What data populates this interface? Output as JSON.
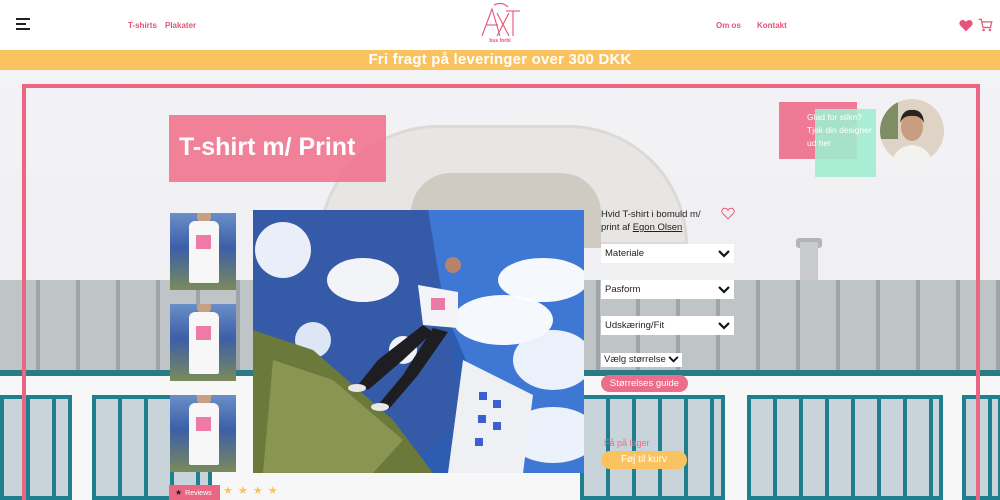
{
  "nav": {
    "links": [
      "T-shirts",
      "Plakater"
    ],
    "right_links": [
      "Om os",
      "Kontakt"
    ],
    "logo_text": "AXT",
    "logo_sub": "bus forbi"
  },
  "banner": {
    "text": "Fri fragt på leveringer over 300 DKK"
  },
  "product": {
    "title": "T-shirt m/ Print",
    "description_prefix": "Hvid T-shirt i bomuld m/ print af ",
    "designer_link": "Egon Olsen",
    "selects": [
      "Materiale",
      "Pasform",
      "Udskæring/Fit",
      "Vælg størrelse"
    ],
    "size_guide": "Størrelses guide",
    "stock_status": "Få på lager",
    "add_to_cart": "Føj til kurv"
  },
  "designer": {
    "text": "Glad for stikn? Tjek din designer ud her"
  },
  "reviews": {
    "label": "Reviews",
    "star_icon": "★",
    "stars": "★ ★ ★ ★"
  },
  "colors": {
    "accent_pink": "#e96783",
    "accent_yellow": "#fbc35f",
    "accent_mint": "#a0ecd0"
  },
  "icons": [
    "menu-icon",
    "heart-icon",
    "cart-icon",
    "chevron-down-icon",
    "star-icon"
  ]
}
